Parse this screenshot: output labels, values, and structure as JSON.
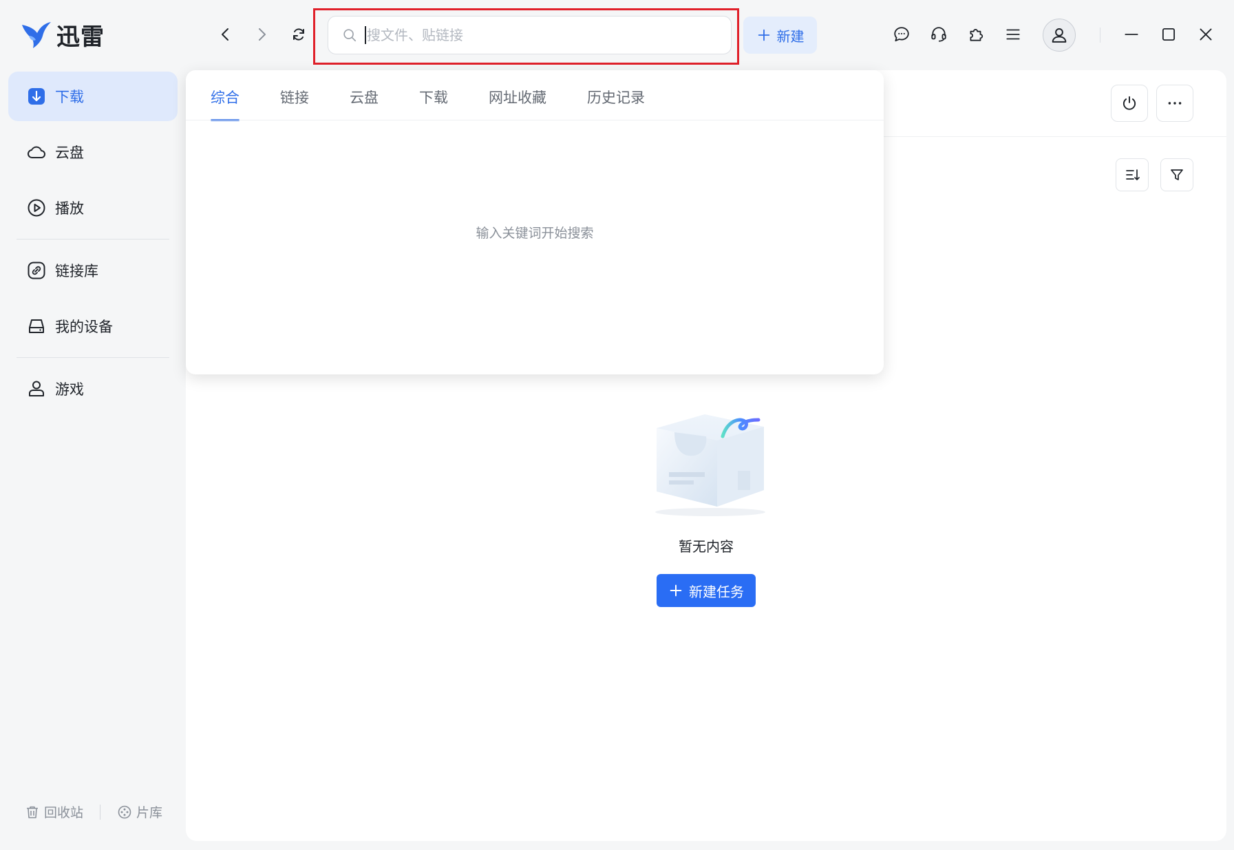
{
  "app": {
    "name": "迅雷",
    "brand_color": "#2f6ee8"
  },
  "search": {
    "placeholder": "搜文件、贴链接",
    "value": ""
  },
  "toolbar": {
    "new_label": "新建"
  },
  "sidebar": {
    "items": [
      {
        "label": "下载",
        "icon": "download-icon",
        "active": true
      },
      {
        "label": "云盘",
        "icon": "cloud-icon"
      },
      {
        "label": "播放",
        "icon": "play-icon"
      },
      {
        "label": "链接库",
        "icon": "link-icon"
      },
      {
        "label": "我的设备",
        "icon": "device-icon"
      },
      {
        "label": "游戏",
        "icon": "game-icon"
      }
    ],
    "bottom": [
      {
        "label": "回收站",
        "icon": "trash-icon"
      },
      {
        "label": "片库",
        "icon": "film-icon"
      }
    ]
  },
  "dropdown": {
    "tabs": [
      "综合",
      "链接",
      "云盘",
      "下载",
      "网址收藏",
      "历史记录"
    ],
    "active_tab": 0,
    "hint": "输入关键词开始搜索"
  },
  "main": {
    "empty_text": "暂无内容",
    "create_task_label": "新建任务"
  },
  "colors": {
    "highlight_border": "#e0202a",
    "primary_button": "#2a6df4"
  }
}
